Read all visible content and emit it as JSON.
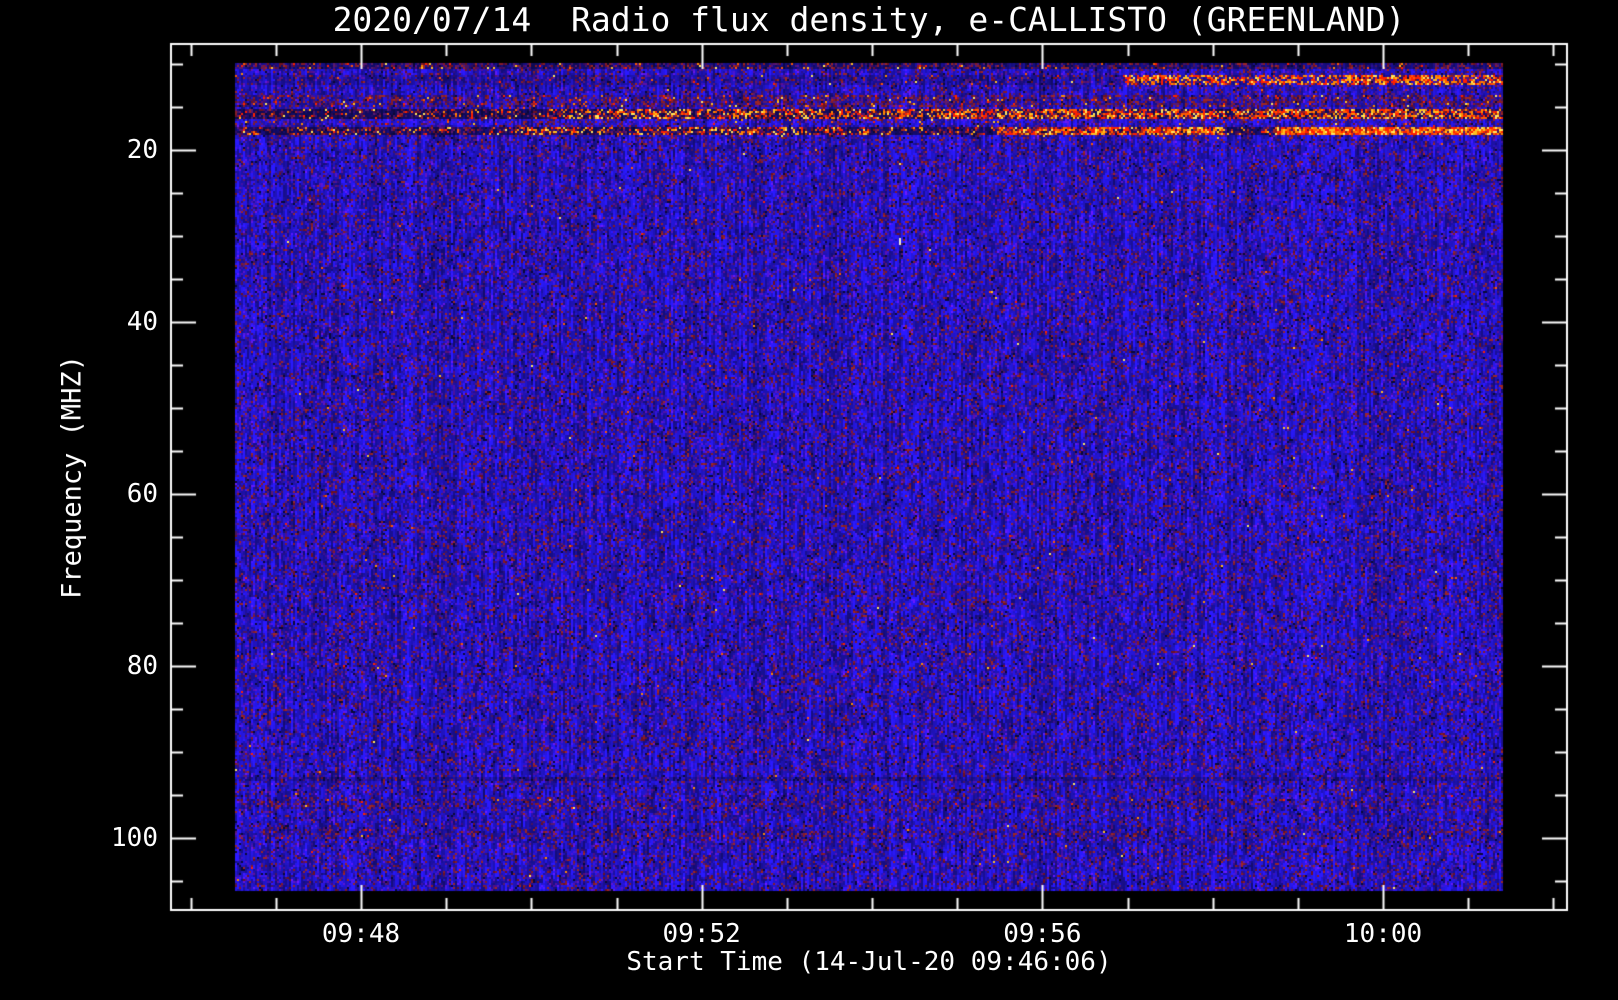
{
  "window": {
    "background": "#000000"
  },
  "chart_data": {
    "type": "heatmap",
    "subtype": "radio-spectrogram",
    "title": "2020/07/14  Radio flux density, e-CALLISTO (GREENLAND)",
    "xlabel": "Start Time (14-Jul-20 09:46:06)",
    "ylabel": "Frequency (MHZ)",
    "x_tick_labels": [
      "09:48",
      "09:52",
      "09:56",
      "10:00"
    ],
    "x_major_tick_every_minutes": 4,
    "x_minor_tick_every_minutes": 1,
    "y_tick_labels": [
      "20",
      "40",
      "60",
      "80",
      "100"
    ],
    "y_tick_values": [
      20,
      40,
      60,
      80,
      100
    ],
    "y_minor_tick_step_mhz": 5,
    "y_range_mhz": [
      9.8,
      106.0
    ],
    "start_time_shown": "09:46:06",
    "grid": false,
    "legend": null,
    "axis_color": "#ffffff",
    "text_color": "#ffffff",
    "colormap": {
      "blue_noise_bright": "#3434f0",
      "blue_noise_dark": "#0d0d72",
      "near_black_cell": "#0a0836",
      "speckle_reds": [
        "#6e1220",
        "#871c26",
        "#9c2626",
        "#5a1a6e",
        "#471460"
      ],
      "burst_brights": [
        "#ff2000",
        "#ff5a00",
        "#ff8c00",
        "#ffc020",
        "#ffe860"
      ]
    },
    "noise_default": {
      "dim": 1.0,
      "p_red": 0.12,
      "p_bright": 0.0015,
      "p_black": 0.04
    },
    "interference_bands": [
      {
        "f0": 9.8,
        "f1": 10.6,
        "dim": 0.5,
        "p_red": 0.3,
        "p_bright": 0.03,
        "segments": []
      },
      {
        "f0": 11.2,
        "f1": 12.5,
        "dim": 0.78,
        "p_red": 0.13,
        "p_bright": 0.01,
        "segments": [
          {
            "t0": 0.7,
            "t1": 0.87,
            "p_bright": 0.5
          },
          {
            "t0": 0.87,
            "t1": 1.0,
            "p_bright": 0.6
          }
        ]
      },
      {
        "f0": 13.6,
        "f1": 15.0,
        "dim": 0.85,
        "p_red": 0.35,
        "p_bright": 0.05,
        "segments": []
      },
      {
        "f0": 15.2,
        "f1": 16.3,
        "dim": 0.34,
        "p_red": 0.22,
        "p_bright": 0.08,
        "segments": [
          {
            "t0": 0.25,
            "t1": 0.55,
            "p_bright": 0.38
          },
          {
            "t0": 0.55,
            "t1": 1.0,
            "p_bright": 0.52
          }
        ]
      },
      {
        "f0": 16.4,
        "f1": 17.1,
        "dim": 1.15,
        "p_red": 0.16,
        "p_bright": 0.015,
        "segments": []
      },
      {
        "f0": 17.2,
        "f1": 18.2,
        "dim": 0.38,
        "p_red": 0.22,
        "p_bright": 0.1,
        "segments": [
          {
            "t0": 0.22,
            "t1": 0.5,
            "p_bright": 0.3
          },
          {
            "t0": 0.6,
            "t1": 0.78,
            "p_bright": 0.62
          },
          {
            "t0": 0.82,
            "t1": 1.0,
            "p_bright": 0.8
          }
        ]
      },
      {
        "f0": 92.8,
        "f1": 93.4,
        "dim": 0.72,
        "p_red": 0.1,
        "p_bright": 0.0,
        "segments": []
      },
      {
        "f0": 95.5,
        "f1": 96.5,
        "dim": 0.92,
        "p_red": 0.22,
        "p_bright": 0.005,
        "segments": []
      },
      {
        "f0": 99.0,
        "f1": 100.0,
        "dim": 0.92,
        "p_red": 0.22,
        "p_bright": 0.005,
        "segments": []
      }
    ],
    "artifact_speck": {
      "t": 0.524,
      "f_mhz": 30.5,
      "color": "#f0ead0"
    }
  }
}
